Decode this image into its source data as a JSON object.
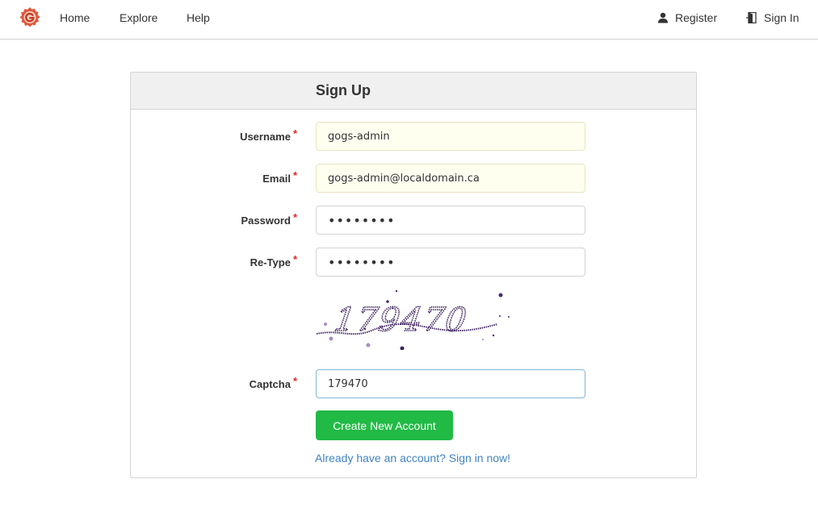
{
  "nav": {
    "home": "Home",
    "explore": "Explore",
    "help": "Help",
    "register": "Register",
    "sign_in": "Sign In"
  },
  "form": {
    "title": "Sign Up",
    "username_label": "Username",
    "username_value": "gogs-admin",
    "email_label": "Email",
    "email_value": "gogs-admin@localdomain.ca",
    "password_label": "Password",
    "password_value": "••••••••",
    "retype_label": "Re-Type",
    "retype_value": "••••••••",
    "captcha_label": "Captcha",
    "captcha_image_text": "179470",
    "captcha_value": "179470",
    "required_mark": "*",
    "submit_label": "Create New Account",
    "signin_prompt": "Already have an account? Sign in now!"
  },
  "colors": {
    "brand": "#e0583a",
    "primary_button": "#21ba45",
    "link": "#4183c4",
    "required": "#db2828"
  },
  "icons": {
    "logo": "gogs-logo-icon",
    "register": "user-icon",
    "sign_in": "sign-in-icon"
  }
}
